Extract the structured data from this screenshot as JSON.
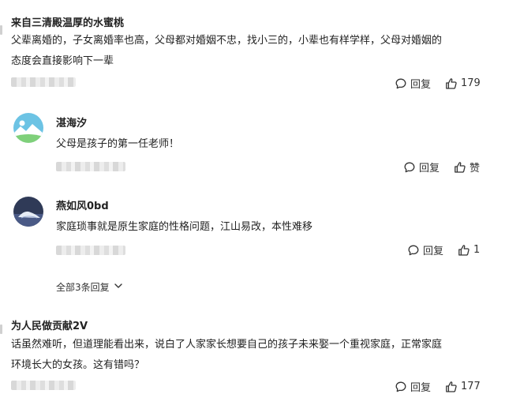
{
  "comments": [
    {
      "username": "来自三清殿温厚的水蜜桃",
      "text_line1": "父辈离婚的，子女离婚率也高，父母都对婚姻不忠，找小三的，小辈也有样学样，父母对婚姻的",
      "text_line2": "态度会直接影响下一辈",
      "reply_label": "回复",
      "like_count": "179"
    },
    {
      "username": "为人民做贡献2V",
      "text_line1": "话虽然难听，但道理能看出来，说白了人家家长想要自己的孩子未来娶一个重视家庭，正常家庭",
      "text_line2": "环境长大的女孩。这有错吗？",
      "reply_label": "回复",
      "like_count": "177"
    }
  ],
  "replies": [
    {
      "username": "湛海汐",
      "text": "父母是孩子的第一任老师！",
      "reply_label": "回复",
      "like_label": "赞"
    },
    {
      "username": "燕如风0bd",
      "text": "家庭琐事就是原生家庭的性格问题，江山易改，本性难移",
      "reply_label": "回复",
      "like_count": "1"
    }
  ],
  "expand": {
    "label": "全部3条回复"
  },
  "icons": {
    "reply": "reply-bubble-icon",
    "like": "thumbs-up-icon",
    "expand": "chevron-down-icon"
  },
  "colors": {
    "text": "#222222",
    "meta": "#333333",
    "blur": "#dcdcdc"
  }
}
